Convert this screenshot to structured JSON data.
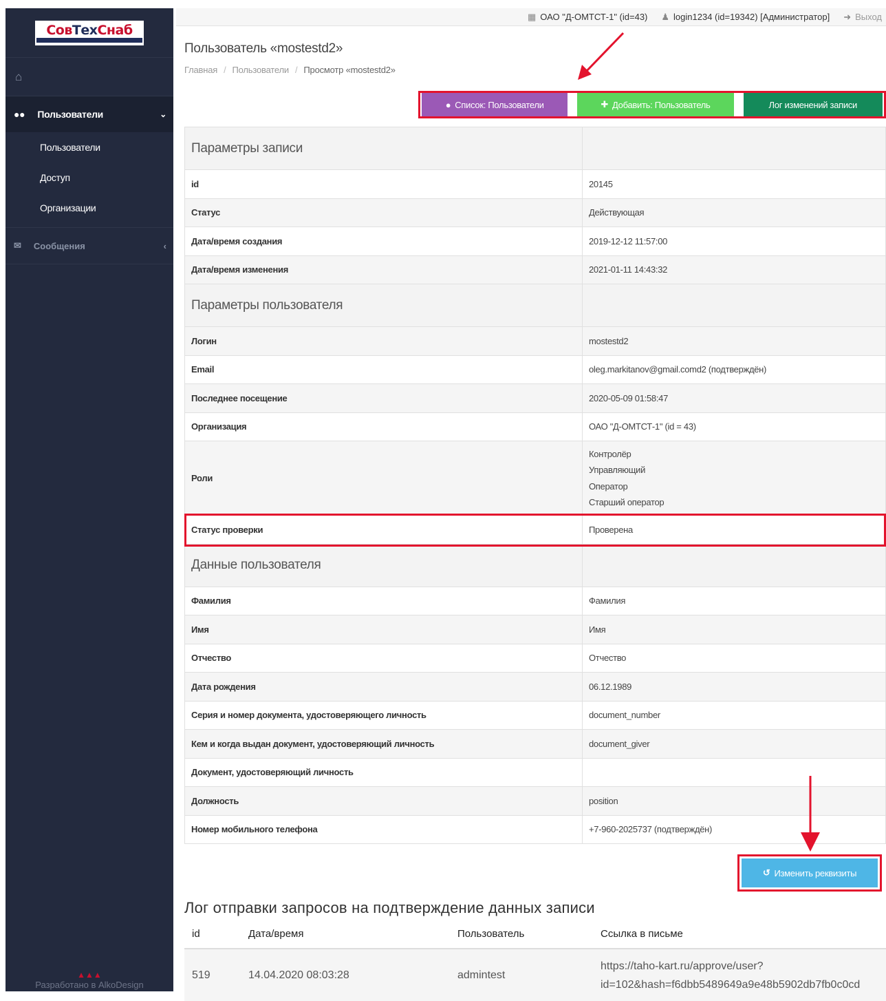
{
  "sidebar": {
    "logo_text_1": "Сов",
    "logo_text_2": "Тех",
    "logo_text_3": "Снаб",
    "menu": {
      "users_head": "Пользователи",
      "sub_items": [
        "Пользователи",
        "Доступ",
        "Организации"
      ],
      "messages": "Сообщения"
    },
    "footer": "Разработано в AlkoDesign"
  },
  "topbar": {
    "org": "ОАО \"Д-ОМТСТ-1\" (id=43)",
    "user": "login1234 (id=19342) [Администратор]",
    "exit": "Выход"
  },
  "page": {
    "title": "Пользователь «mostestd2»",
    "breadcrumbs": [
      "Главная",
      "Пользователи",
      "Просмотр «mostestd2»"
    ]
  },
  "actions": {
    "list": "Список: Пользователи",
    "add": "Добавить: Пользователь",
    "log": "Лог изменений записи"
  },
  "sections": {
    "record": "Параметры записи",
    "user_params": "Параметры пользователя",
    "user_data": "Данные пользователя"
  },
  "record": {
    "id_k": "id",
    "id_v": "20145",
    "status_k": "Статус",
    "status_v": "Действующая",
    "created_k": "Дата/время создания",
    "created_v": "2019-12-12 11:57:00",
    "modified_k": "Дата/время изменения",
    "modified_v": "2021-01-11 14:43:32"
  },
  "user_params": {
    "login_k": "Логин",
    "login_v": "mostestd2",
    "email_k": "Email",
    "email_v": "oleg.markitanov@gmail.comd2 (подтверждён)",
    "last_k": "Последнее посещение",
    "last_v": "2020-05-09 01:58:47",
    "org_k": "Организация",
    "org_v": "ОАО \"Д-ОМТСТ-1\" (id = 43)",
    "roles_k": "Роли",
    "roles": [
      "Контролёр",
      "Управляющий",
      "Оператор",
      "Старший оператор"
    ],
    "verif_k": "Статус проверки",
    "verif_v": "Проверена"
  },
  "user_data": {
    "surname_k": "Фамилия",
    "surname_v": "Фамилия",
    "name_k": "Имя",
    "name_v": "Имя",
    "patr_k": "Отчество",
    "patr_v": "Отчество",
    "birth_k": "Дата рождения",
    "birth_v": "06.12.1989",
    "docnum_k": "Серия и номер документа, удостоверяющего личность",
    "docnum_v": "document_number",
    "docgiver_k": "Кем и когда выдан документ, удостоверяющий личность",
    "docgiver_v": "document_giver",
    "doc_k": "Документ, удостоверяющий личность",
    "doc_v": "",
    "position_k": "Должность",
    "position_v": "position",
    "phone_k": "Номер мобильного телефона",
    "phone_v": "+7-960-2025737 (подтверждён)"
  },
  "edit_button": "Изменить реквизиты",
  "log": {
    "title": "Лог отправки запросов на подтверждение данных записи",
    "headers": [
      "id",
      "Дата/время",
      "Пользователь",
      "Ссылка в письме"
    ],
    "row": {
      "id": "519",
      "datetime": "14.04.2020 08:03:28",
      "user": "admintest",
      "link_1": "https://taho-kart.ru/approve/user?",
      "link_2": "id=102&hash=f6dbb5489649a9e48b5902db7fb0c0cd"
    }
  },
  "colors": {
    "sidebar": "#232a3e",
    "highlight": "#e3132d",
    "purple": "#9b59b6",
    "green": "#5cd65c",
    "dark_green": "#148a5a",
    "blue": "#4eb6e6"
  }
}
